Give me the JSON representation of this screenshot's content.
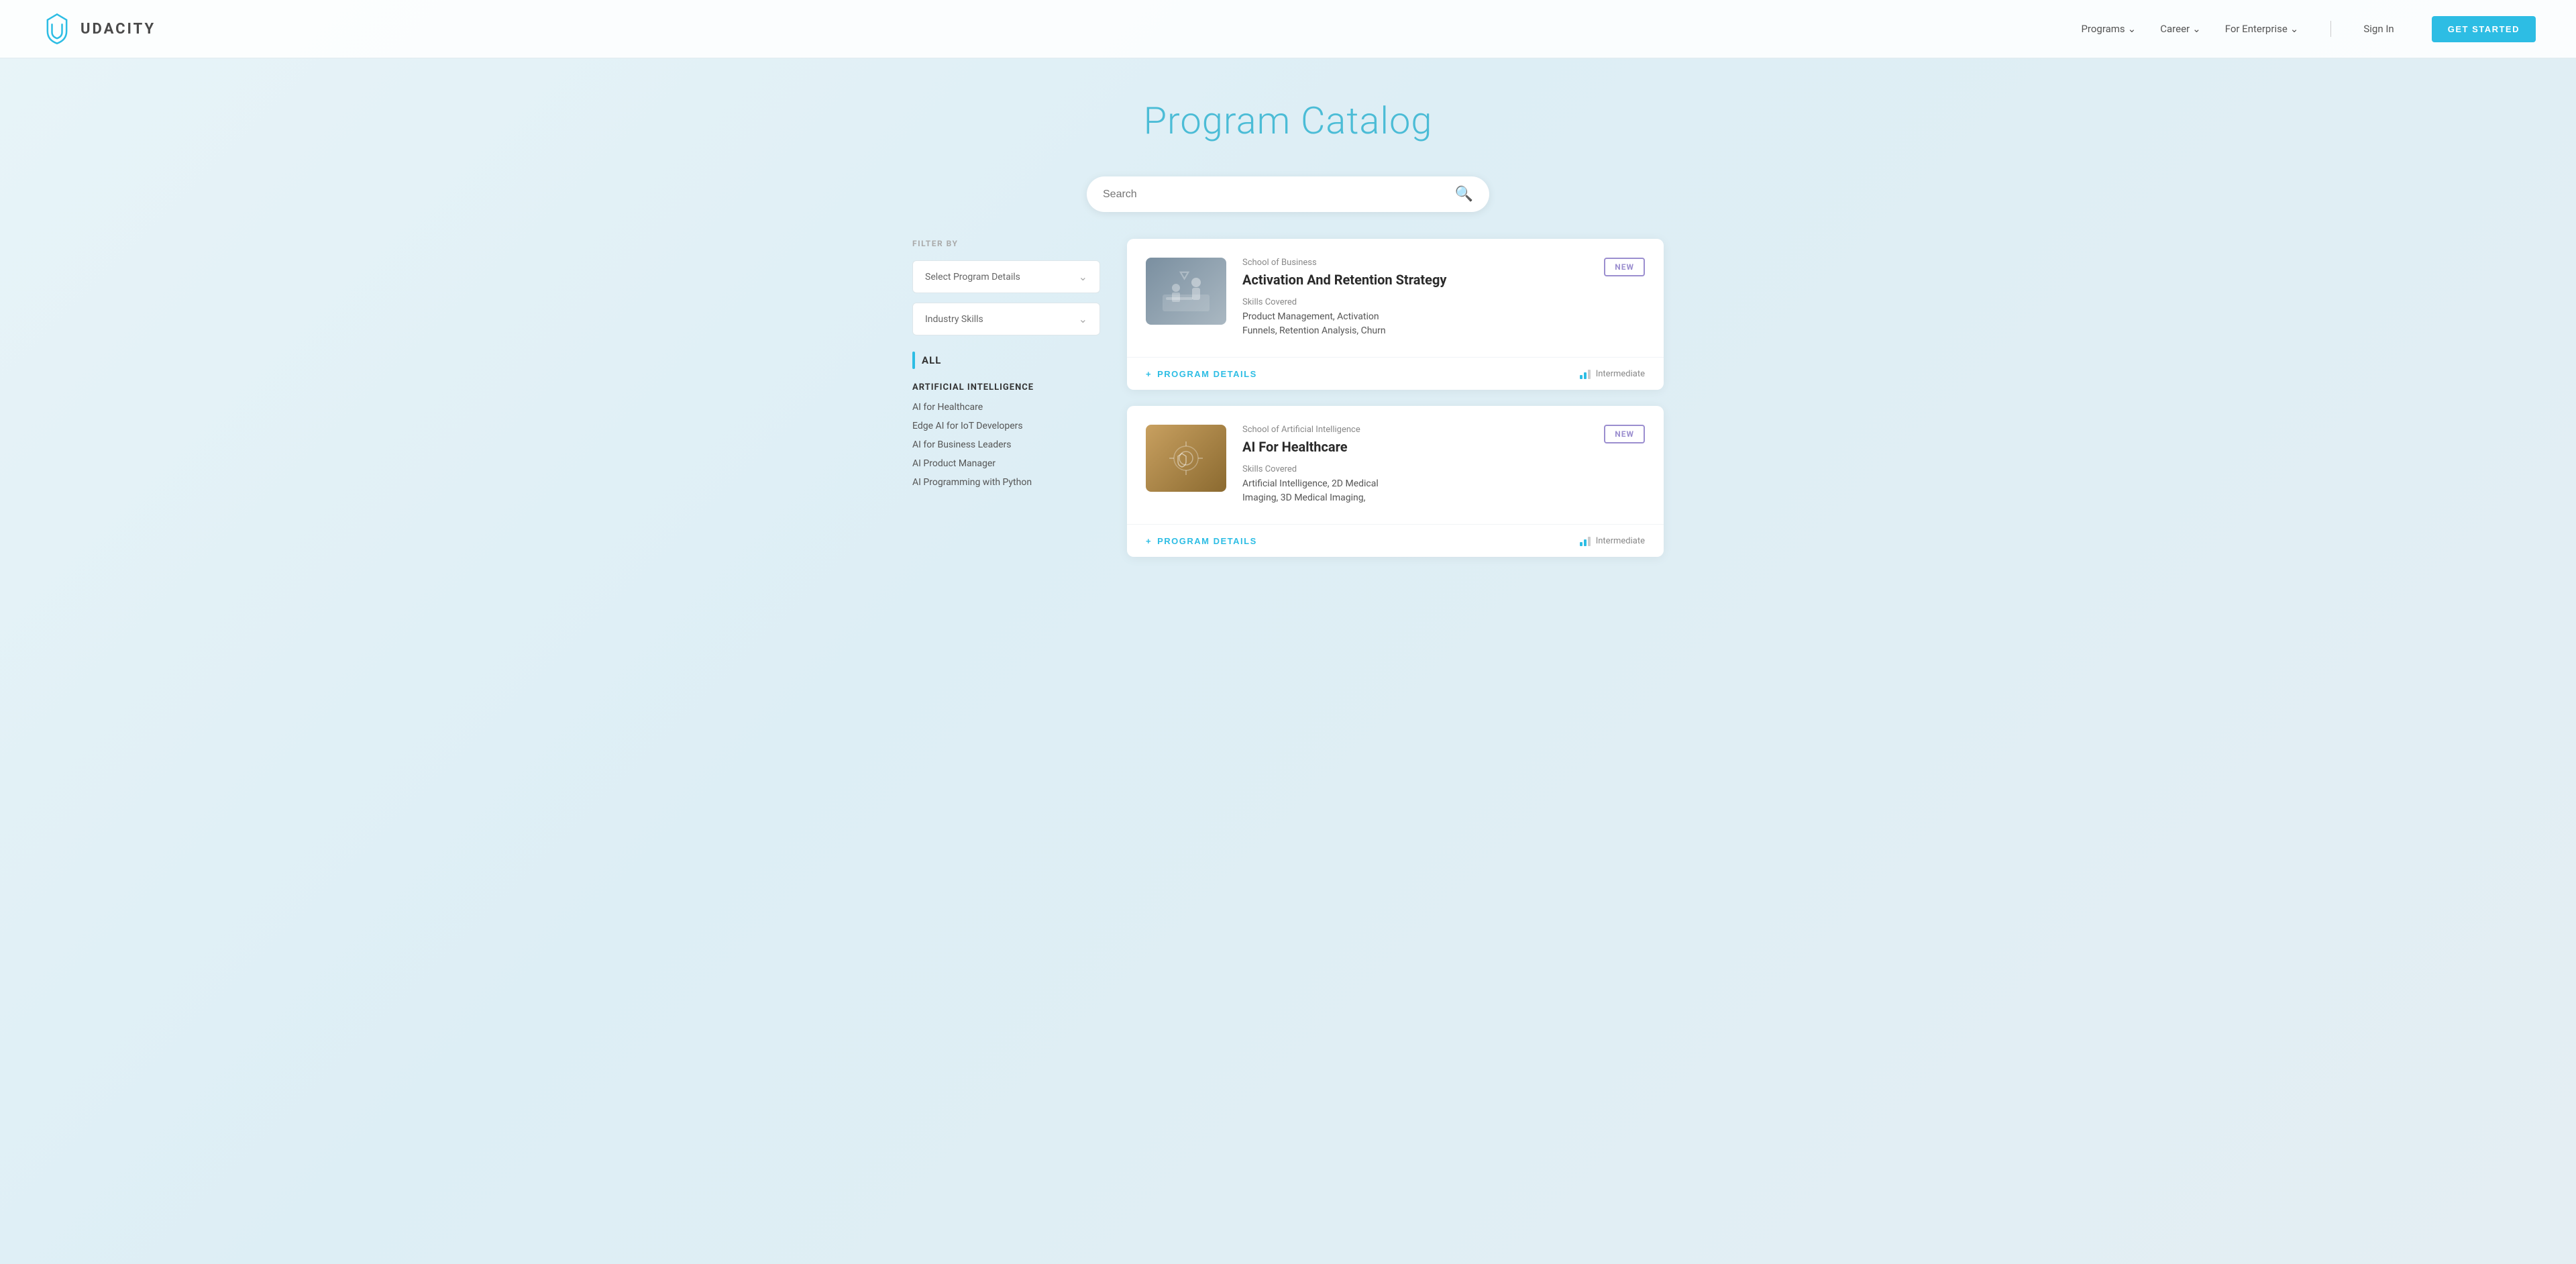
{
  "nav": {
    "logo_text": "UDACITY",
    "links": [
      {
        "label": "Programs",
        "has_dropdown": true
      },
      {
        "label": "Career",
        "has_dropdown": true
      },
      {
        "label": "For Enterprise",
        "has_dropdown": true
      }
    ],
    "sign_in": "Sign In",
    "get_started": "GET STARTED"
  },
  "hero": {
    "title": "Program Catalog"
  },
  "search": {
    "placeholder": "Search"
  },
  "sidebar": {
    "filter_by": "FILTER BY",
    "dropdown1": "Select Program Details",
    "dropdown2": "Industry Skills",
    "all_label": "ALL",
    "section_title": "ARTIFICIAL INTELLIGENCE",
    "items": [
      {
        "label": "AI for Healthcare"
      },
      {
        "label": "Edge AI for IoT Developers"
      },
      {
        "label": "AI for Business Leaders"
      },
      {
        "label": "AI Product Manager"
      },
      {
        "label": "AI Programming with Python"
      }
    ]
  },
  "cards": [
    {
      "school": "School of Business",
      "title": "Activation And Retention Strategy",
      "is_new": true,
      "new_label": "NEW",
      "skills_label": "Skills Covered",
      "skills": "Product Management, Activation Funnels, Retention Analysis, Churn",
      "program_details_label": "PROGRAM DETAILS",
      "difficulty": "Intermediate",
      "thumb_type": "business"
    },
    {
      "school": "School of Artificial Intelligence",
      "title": "AI For Healthcare",
      "is_new": true,
      "new_label": "NEW",
      "skills_label": "Skills Covered",
      "skills": "Artificial Intelligence, 2D Medical Imaging, 3D Medical Imaging,",
      "program_details_label": "PROGRAM DETAILS",
      "difficulty": "Intermediate",
      "thumb_type": "healthcare"
    }
  ]
}
